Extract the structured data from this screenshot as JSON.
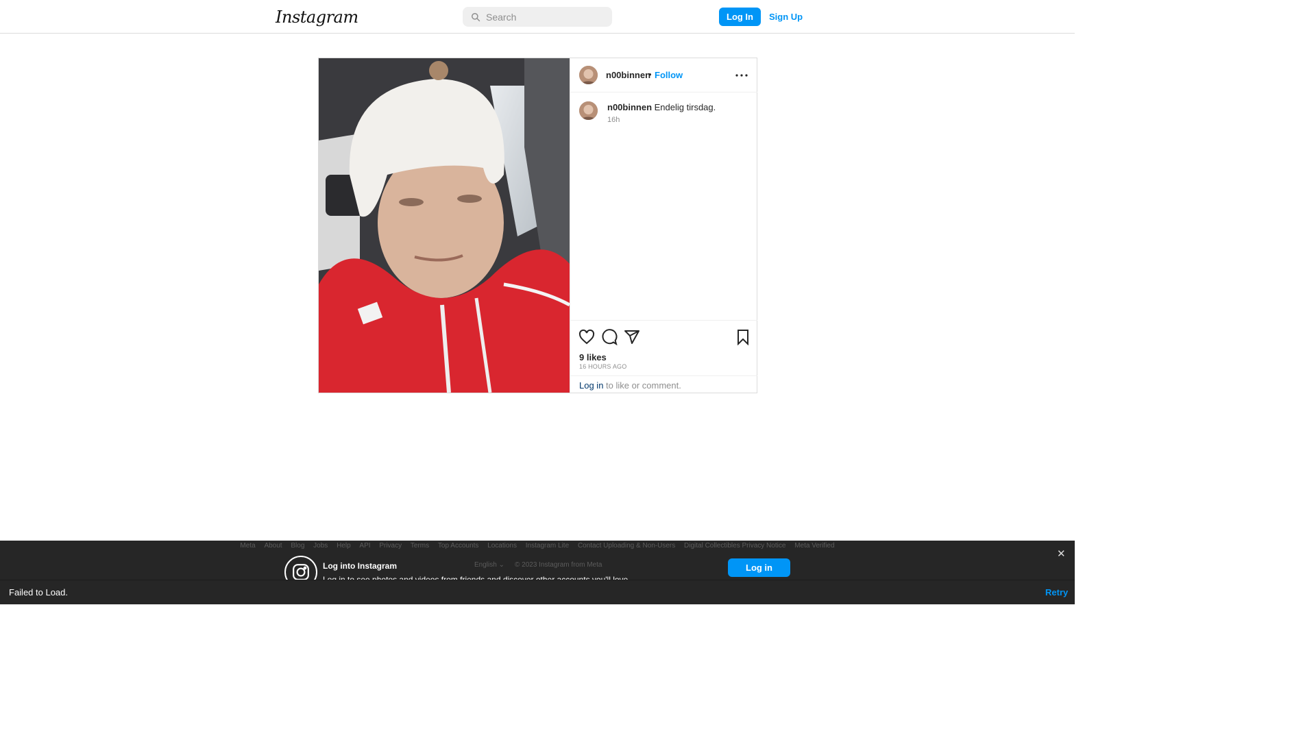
{
  "header": {
    "logo_text": "Instagram",
    "search_placeholder": "Search",
    "login_label": "Log In",
    "signup_label": "Sign Up"
  },
  "post": {
    "username": "n00binnen",
    "separator": "•",
    "follow_label": "Follow",
    "caption_username": "n00binnen",
    "caption_text": "Endelig tirsdag.",
    "caption_time": "16h",
    "likes": "9 likes",
    "posted_ago": "16 HOURS AGO",
    "login_link": "Log in",
    "login_rest": " to like or comment."
  },
  "footer": {
    "links": [
      "Meta",
      "About",
      "Blog",
      "Jobs",
      "Help",
      "API",
      "Privacy",
      "Terms",
      "Top Accounts",
      "Locations",
      "Instagram Lite",
      "Contact Uploading & Non-Users",
      "Digital Collectibles Privacy Notice",
      "Meta Verified"
    ],
    "promo_title": "Log into Instagram",
    "promo_sub": "Log in to see photos and videos from friends and discover other accounts you'll love.",
    "language": "English",
    "copyright": "© 2023 Instagram from Meta",
    "login_label": "Log in",
    "close_label": "✕"
  },
  "toast": {
    "text": "Failed to Load.",
    "retry_label": "Retry"
  },
  "colors": {
    "accent": "#0095f6",
    "jacket_red": "#d9262f"
  }
}
